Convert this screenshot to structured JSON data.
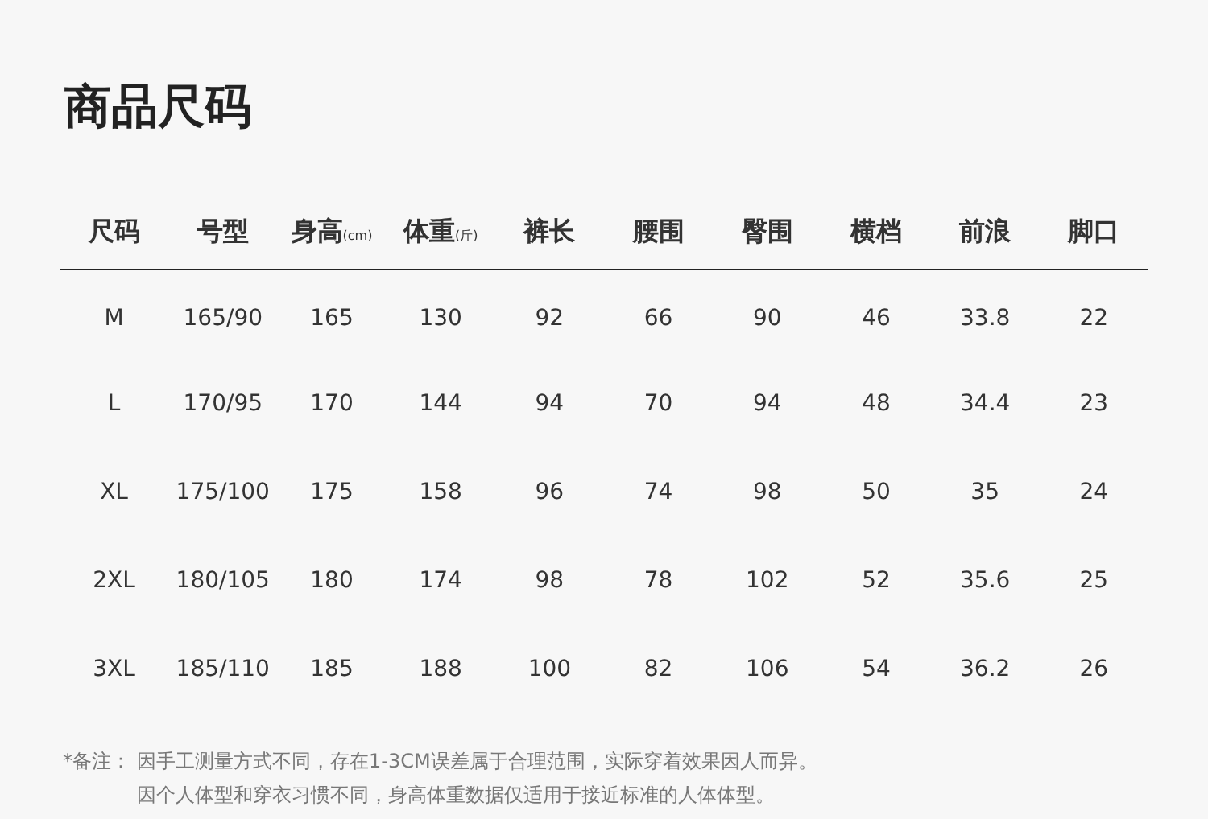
{
  "title": "商品尺码",
  "table": {
    "columns": [
      {
        "label": "尺码"
      },
      {
        "label": "号型"
      },
      {
        "label": "身高",
        "unit": "(cm)"
      },
      {
        "label": "体重",
        "unit": "(斤)"
      },
      {
        "label": "裤长"
      },
      {
        "label": "腰围"
      },
      {
        "label": "臀围"
      },
      {
        "label": "横档"
      },
      {
        "label": "前浪"
      },
      {
        "label": "脚口"
      }
    ],
    "rows": [
      [
        "M",
        "165/90",
        "165",
        "130",
        "92",
        "66",
        "90",
        "46",
        "33.8",
        "22"
      ],
      [
        "L",
        "170/95",
        "170",
        "144",
        "94",
        "70",
        "94",
        "48",
        "34.4",
        "23"
      ],
      [
        "XL",
        "175/100",
        "175",
        "158",
        "96",
        "74",
        "98",
        "50",
        "35",
        "24"
      ],
      [
        "2XL",
        "180/105",
        "180",
        "174",
        "98",
        "78",
        "102",
        "52",
        "35.6",
        "25"
      ],
      [
        "3XL",
        "185/110",
        "185",
        "188",
        "100",
        "82",
        "106",
        "54",
        "36.2",
        "26"
      ]
    ]
  },
  "note": {
    "label": "*备注：",
    "lines": [
      "因手工测量方式不同，存在1-3CM误差属于合理范围，实际穿着效果因人而异。",
      "因个人体型和穿衣习惯不同，身高体重数据仅适用于接近标准的人体体型。"
    ]
  }
}
